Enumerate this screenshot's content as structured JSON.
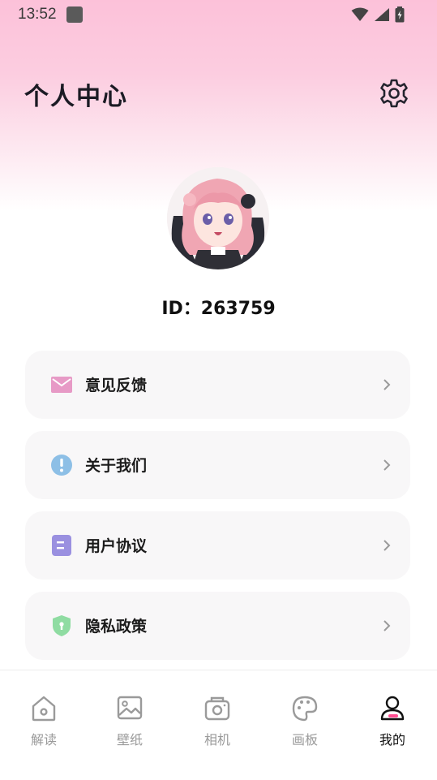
{
  "status_bar": {
    "time": "13:52"
  },
  "header": {
    "title": "个人中心"
  },
  "profile": {
    "id_text": "ID：263759"
  },
  "menu": [
    {
      "label": "意见反馈",
      "icon": "mail-icon",
      "color": "#e79ac6"
    },
    {
      "label": "关于我们",
      "icon": "info-icon",
      "color": "#8dbfe6"
    },
    {
      "label": "用户协议",
      "icon": "document-icon",
      "color": "#9a90e0"
    },
    {
      "label": "隐私政策",
      "icon": "shield-icon",
      "color": "#8fdca2"
    }
  ],
  "tabs": [
    {
      "label": "解读",
      "icon": "home-icon",
      "active": false
    },
    {
      "label": "壁纸",
      "icon": "image-icon",
      "active": false
    },
    {
      "label": "相机",
      "icon": "camera-icon",
      "active": false
    },
    {
      "label": "画板",
      "icon": "palette-icon",
      "active": false
    },
    {
      "label": "我的",
      "icon": "user-icon",
      "active": true
    }
  ],
  "colors": {
    "accent": "#ff4e91",
    "header_gradient_top": "#fcc1d9"
  }
}
